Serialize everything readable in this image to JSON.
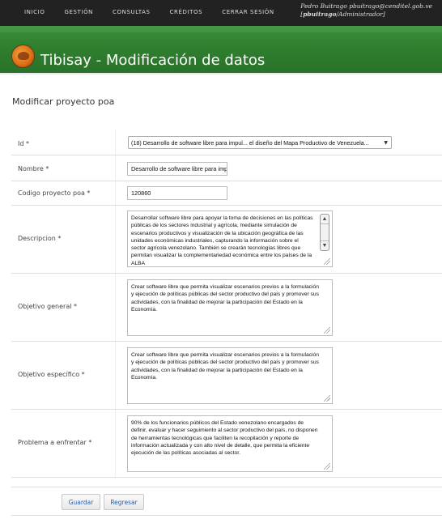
{
  "nav": {
    "items": [
      "INICIO",
      "GESTIÓN",
      "CONSULTAS",
      "CRÉDITOS",
      "CERRAR SESIÓN"
    ]
  },
  "user": {
    "line1": "Pedro Buitrago pbuitrago@cenditel.gob.ve",
    "line2_prefix": "[",
    "username": "pbuitrago",
    "line2_suffix": "/Administrador]"
  },
  "app": {
    "title": "Tibisay - Modificación de datos"
  },
  "page": {
    "heading": "Modificar proyecto poa"
  },
  "form": {
    "id": {
      "label": "Id *",
      "selected": "(18) Desarrollo de software libre para impul... el diseño del Mapa Productivo de Venezuela..."
    },
    "nombre": {
      "label": "Nombre *",
      "value": "Desarrollo de software libre para impulsar"
    },
    "codigo": {
      "label": "Codigo proyecto poa *",
      "value": "120860"
    },
    "descripcion": {
      "label": "Descripcion *",
      "value": "Desarrollar software libre para apoyar la toma de decisiones en las políticas públicas de los sectores industrial y agrícola, mediante simulación de escenarios productivos y visualización de la ubicación geográfica de las unidades económicas industriales, capturando la información sobre el sector agrícola venezolano. También se crearán tecnologías libres que permitan visualizar la complementariedad económica entre los países de la ALBA"
    },
    "objetivo_general": {
      "label": "Objetivo general *",
      "value": "Crear software libre que permita visualizar escenarios previos a la formulación y ejecución de políticas públicas del sector productivo del país y promover sus actividades, con la finalidad de mejorar la participación del Estado en la Economía."
    },
    "objetivo_especifico": {
      "label": "Objetivo específico *",
      "value": "Crear software libre que permita visualizar escenarios previos a la formulación y ejecución de políticas públicas del sector productivo del país y promover sus actividades, con la finalidad de mejorar la participación del Estado en la Economía."
    },
    "problema": {
      "label": "Problema a enfrentar *",
      "value": "90% de los funcionarios públicos del Estado venezolano encargados de definir, evaluar y hacer seguimiento al sector productivo del país, no disponen de herramientas tecnológicas que faciliten la recopilación y reporte de información actualizada y con alto nivel de detalle, que permita la eficiente ejecución de las políticas asociadas al sector."
    }
  },
  "buttons": {
    "save": "Guardar",
    "back": "Regresar"
  }
}
